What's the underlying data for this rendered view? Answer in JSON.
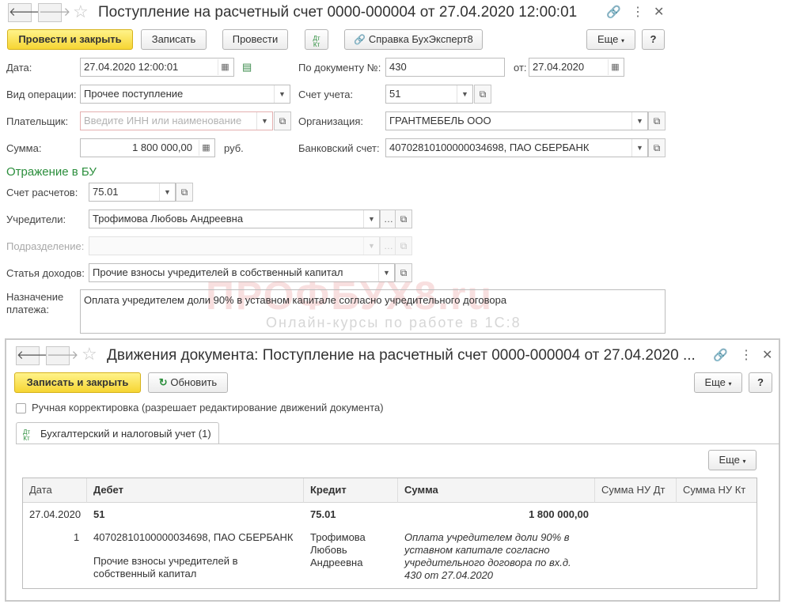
{
  "doc": {
    "title": "Поступление на расчетный счет 0000-000004 от 27.04.2020 12:00:01",
    "toolbar": {
      "post_close": "Провести и закрыть",
      "save": "Записать",
      "post": "Провести",
      "dtkt": "Дт Кт",
      "help": "Справка БухЭксперт8",
      "more": "Еще",
      "question": "?"
    },
    "fields": {
      "date_label": "Дата:",
      "date_value": "27.04.2020 12:00:01",
      "doc_num_label": "По документу №:",
      "doc_num_value": "430",
      "from_label": "от:",
      "from_value": "27.04.2020",
      "op_label": "Вид операции:",
      "op_value": "Прочее поступление",
      "account_label": "Счет учета:",
      "account_value": "51",
      "payer_label": "Плательщик:",
      "payer_placeholder": "Введите ИНН или наименование",
      "org_label": "Организация:",
      "org_value": "ГРАНТМЕБЕЛЬ ООО",
      "sum_label": "Сумма:",
      "sum_value": "1 800 000,00",
      "currency": "руб.",
      "bank_label": "Банковский счет:",
      "bank_value": "40702810100000034698, ПАО СБЕРБАНК"
    },
    "bu": {
      "section": "Отражение в БУ",
      "settle_label": "Счет расчетов:",
      "settle_value": "75.01",
      "founders_label": "Учредители:",
      "founders_value": "Трофимова Любовь Андреевна",
      "dept_label": "Подразделение:",
      "dept_value": "",
      "income_label": "Статья доходов:",
      "income_value": "Прочие взносы учредителей в собственный капитал"
    },
    "purpose_label_1": "Назначение",
    "purpose_label_2": "платежа:",
    "purpose_value": "Оплата учредителем доли 90% в уставном капитале согласно учредительного договора"
  },
  "watermark": {
    "main": "ПРОФБУХ8.ru",
    "sub": "Онлайн-курсы по работе в 1С:8"
  },
  "movements": {
    "title": "Движения документа: Поступление на расчетный счет 0000-000004 от 27.04.2020 ...",
    "save_close": "Записать и закрыть",
    "refresh": "Обновить",
    "more": "Еще",
    "question": "?",
    "manual_check": "Ручная корректировка (разрешает редактирование движений документа)",
    "tab": "Бухгалтерский и налоговый учет (1)",
    "grid_more": "Еще",
    "columns": [
      "Дата",
      "Дебет",
      "Кредит",
      "Сумма",
      "Сумма НУ Дт",
      "Сумма НУ Кт"
    ],
    "row": {
      "date": "27.04.2020",
      "num": "1",
      "debit_account": "51",
      "debit_sub1": "40702810100000034698, ПАО СБЕРБАНК",
      "debit_sub2_line1": "Прочие взносы учредителей в",
      "debit_sub2_line2": "собственный капитал",
      "credit_account": "75.01",
      "credit_sub1_line1": "Трофимова",
      "credit_sub1_line2": "Любовь",
      "credit_sub1_line3": "Андреевна",
      "sum": "1 800 000,00",
      "content_line1": "Оплата учредителем доли 90% в",
      "content_line2": "уставном капитале согласно",
      "content_line3": "учредительного договора по вх.д.",
      "content_line4": "430 от 27.04.2020"
    }
  }
}
